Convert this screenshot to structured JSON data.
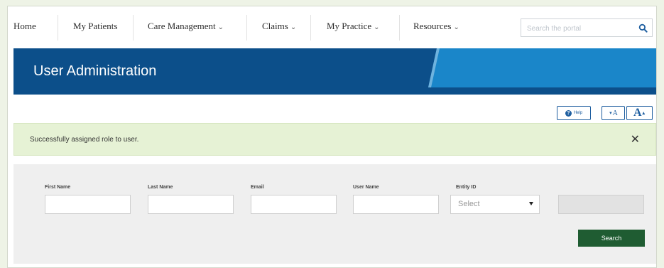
{
  "nav": {
    "items": [
      {
        "label": "Home"
      },
      {
        "label": "My Patients"
      },
      {
        "label": "Care Management",
        "caret": "⌄"
      },
      {
        "label": "Claims",
        "caret": "⌄"
      },
      {
        "label": "My Practice",
        "caret": "⌄"
      },
      {
        "label": "Resources",
        "caret": "⌄"
      }
    ],
    "search_placeholder": "Search the portal"
  },
  "banner": {
    "title": "User Administration",
    "colors": {
      "light": "#1a86c9",
      "dark": "#0c4f8a"
    }
  },
  "tools": {
    "help_label": "Help",
    "help_glyph": "?",
    "font_decrease_label": "A",
    "font_increase_label": "A",
    "decrease_glyph": "▾",
    "increase_glyph": "▴"
  },
  "alert": {
    "message": "Successfully assigned role to user.",
    "close_glyph": "✕"
  },
  "search_form": {
    "labels": {
      "first_name": "First Name",
      "last_name": "Last Name",
      "email": "Email",
      "user_name": "User Name",
      "entity_id": "Entity ID"
    },
    "entity_select_value": "Select",
    "search_button": "Search"
  }
}
